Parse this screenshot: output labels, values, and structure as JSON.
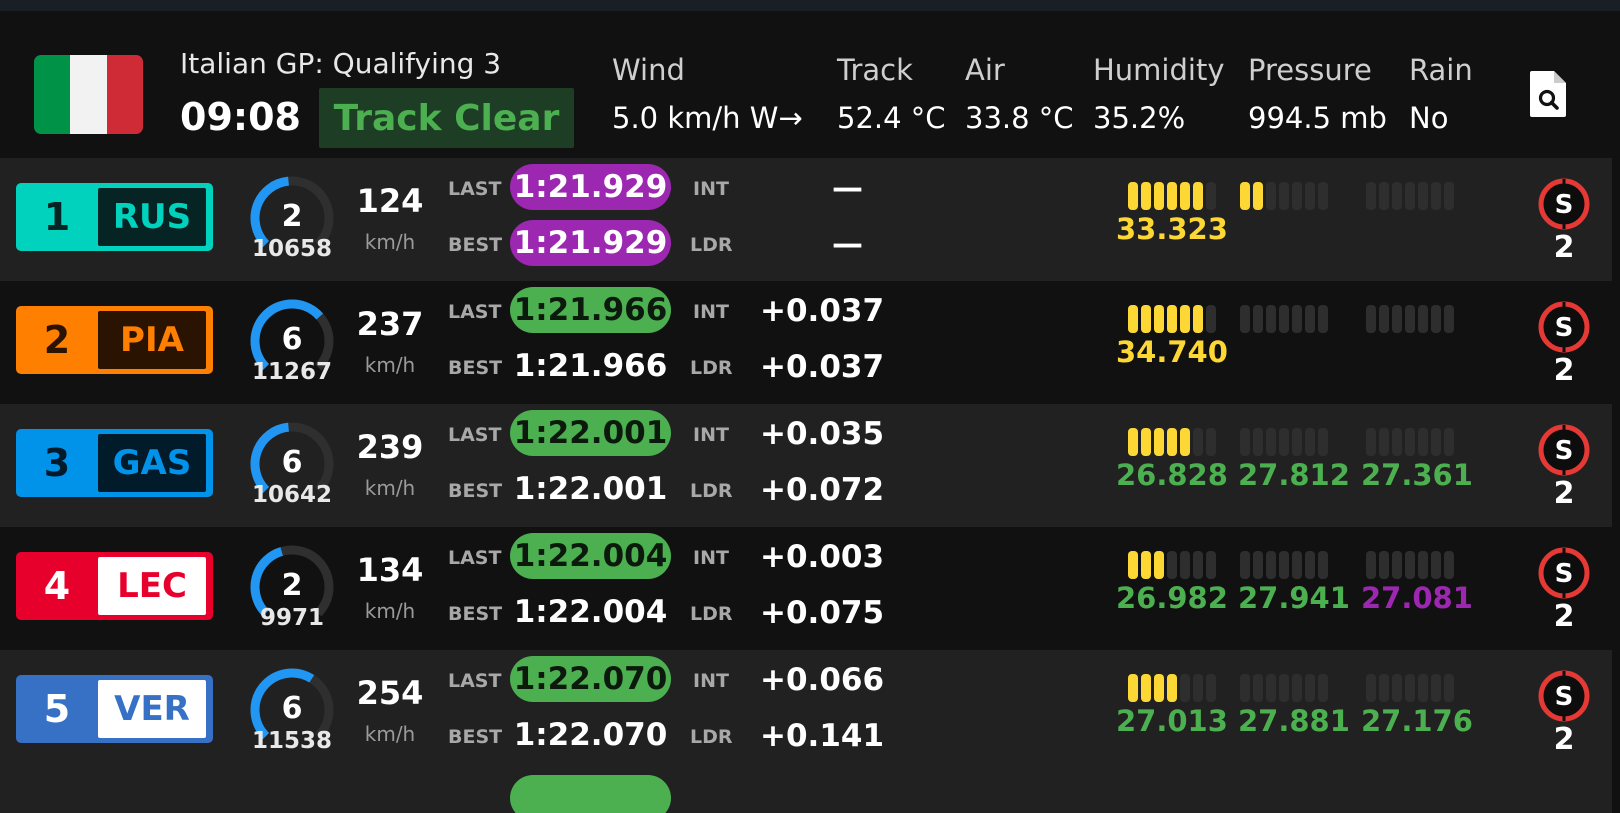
{
  "header": {
    "event": "Italian GP: Qualifying 3",
    "time": "09:08",
    "status": "Track Clear",
    "weather": [
      {
        "label": "Wind",
        "value": "5.0 km/h W→"
      },
      {
        "label": "Track",
        "value": "52.4 °C"
      },
      {
        "label": "Air",
        "value": "33.8 °C"
      },
      {
        "label": "Humidity",
        "value": "35.2%"
      },
      {
        "label": "Pressure",
        "value": "994.5 mb"
      },
      {
        "label": "Rain",
        "value": "No"
      }
    ],
    "flag_colors": [
      "#009246",
      "#f1f2f1",
      "#ce2b37"
    ],
    "icons": {
      "flag": "italy-flag-icon",
      "report": "document-search-icon",
      "tyre": "soft-tyre-icon"
    }
  },
  "labels": {
    "last": "LAST",
    "best": "BEST",
    "int": "INT",
    "ldr": "LDR",
    "speed_unit": "km/h"
  },
  "colors": {
    "purple": "#9c27b0",
    "green": "#4caf50",
    "yellow": "#fdd835",
    "gear_arc": "#2196f3",
    "tyre_soft": "#e53935"
  },
  "drivers": [
    {
      "position": "1",
      "code": "RUS",
      "team_color": "#00d2be",
      "code_bg": "#062423",
      "code_color": "#00d2be",
      "gear": "2",
      "rpm": "10658",
      "rpm_level": 0.48,
      "speed": "124",
      "last": "1:21.929",
      "last_style": "purple",
      "best": "1:21.929",
      "best_style": "purple",
      "int": "—",
      "ldr": "—",
      "mini_sectors": [
        6,
        2,
        0
      ],
      "sectors": [
        {
          "time": "33.323",
          "color": "yellow"
        },
        {
          "time": "",
          "color": "green"
        },
        {
          "time": "",
          "color": "green"
        }
      ],
      "tyre": "S",
      "tyre_age": "2"
    },
    {
      "position": "2",
      "code": "PIA",
      "team_color": "#ff8000",
      "code_bg": "#2b1302",
      "code_color": "#ff8000",
      "gear": "6",
      "rpm": "11267",
      "rpm_level": 0.68,
      "speed": "237",
      "last": "1:21.966",
      "last_style": "green",
      "best": "1:21.966",
      "best_style": "plain",
      "int": "+0.037",
      "ldr": "+0.037",
      "mini_sectors": [
        6,
        0,
        0
      ],
      "sectors": [
        {
          "time": "34.740",
          "color": "yellow"
        },
        {
          "time": "",
          "color": "green"
        },
        {
          "time": "",
          "color": "green"
        }
      ],
      "tyre": "S",
      "tyre_age": "2"
    },
    {
      "position": "3",
      "code": "GAS",
      "team_color": "#0093e9",
      "code_bg": "#011b2b",
      "code_color": "#0093e9",
      "gear": "6",
      "rpm": "10642",
      "rpm_level": 0.48,
      "speed": "239",
      "last": "1:22.001",
      "last_style": "green",
      "best": "1:22.001",
      "best_style": "plain",
      "int": "+0.035",
      "ldr": "+0.072",
      "mini_sectors": [
        5,
        0,
        0
      ],
      "sectors": [
        {
          "time": "26.828",
          "color": "green"
        },
        {
          "time": "27.812",
          "color": "green"
        },
        {
          "time": "27.361",
          "color": "green"
        }
      ],
      "tyre": "S",
      "tyre_age": "2"
    },
    {
      "position": "4",
      "code": "LEC",
      "team_color": "#e8002d",
      "code_bg": "#ffffff",
      "code_color": "#e8002d",
      "gear": "2",
      "rpm": "9971",
      "rpm_level": 0.44,
      "speed": "134",
      "last": "1:22.004",
      "last_style": "green",
      "best": "1:22.004",
      "best_style": "plain",
      "int": "+0.003",
      "ldr": "+0.075",
      "mini_sectors": [
        3,
        0,
        0
      ],
      "sectors": [
        {
          "time": "26.982",
          "color": "green"
        },
        {
          "time": "27.941",
          "color": "green"
        },
        {
          "time": "27.081",
          "color": "purple"
        }
      ],
      "tyre": "S",
      "tyre_age": "2"
    },
    {
      "position": "5",
      "code": "VER",
      "team_color": "#3671c6",
      "code_bg": "#ffffff",
      "code_color": "#3671c6",
      "gear": "6",
      "rpm": "11538",
      "rpm_level": 0.62,
      "speed": "254",
      "last": "1:22.070",
      "last_style": "green",
      "best": "1:22.070",
      "best_style": "plain",
      "int": "+0.066",
      "ldr": "+0.141",
      "mini_sectors": [
        4,
        0,
        0
      ],
      "sectors": [
        {
          "time": "27.013",
          "color": "green"
        },
        {
          "time": "27.881",
          "color": "green"
        },
        {
          "time": "27.176",
          "color": "green"
        }
      ],
      "tyre": "S",
      "tyre_age": "2"
    }
  ]
}
